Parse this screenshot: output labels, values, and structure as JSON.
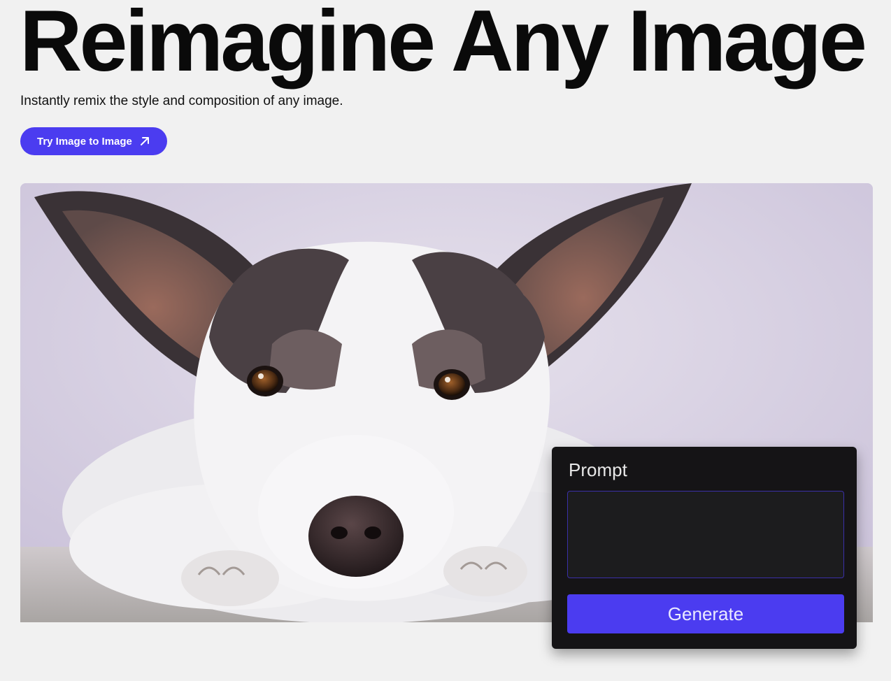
{
  "hero": {
    "title": "Reimagine Any Image",
    "subtitle": "Instantly remix the style and composition of any image.",
    "cta_label": "Try Image to Image",
    "cta_icon": "arrow-up-right-icon"
  },
  "colors": {
    "accent": "#4b3cf0",
    "page_background": "#f1f1f1",
    "panel_background": "#151416",
    "input_border": "#3a2fa8"
  },
  "image": {
    "subject": "dog-photo"
  },
  "prompt_panel": {
    "label": "Prompt",
    "input_value": "",
    "generate_label": "Generate"
  }
}
